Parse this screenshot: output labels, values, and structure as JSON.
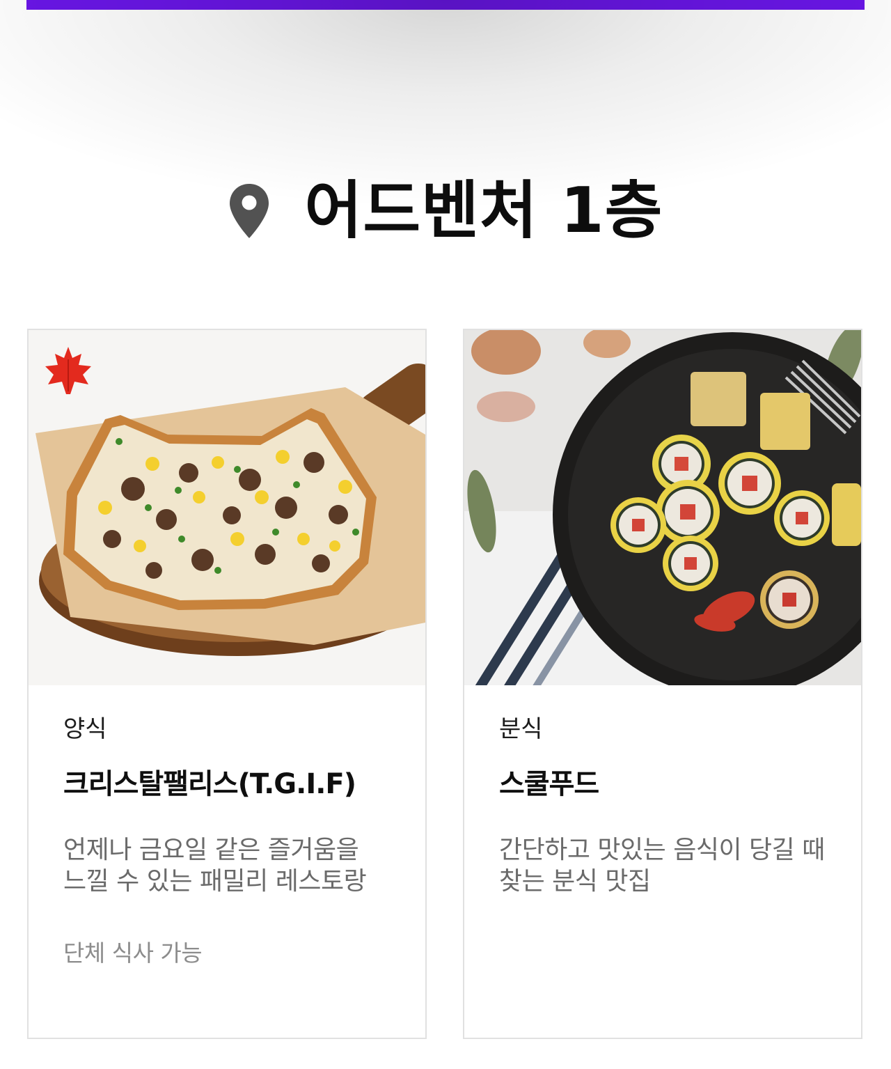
{
  "header": {
    "floor_title": "어드벤처 1층",
    "location_icon": "location-pin-icon"
  },
  "colors": {
    "top_bar": "#6a16e8",
    "title": "#0d0d0d",
    "card_border": "#e1e1e1",
    "description": "#6a6a6a",
    "note": "#8c8c8c"
  },
  "restaurants": [
    {
      "image": "pizza-photo",
      "badge_icon": "maple-leaf-icon",
      "category": "양식",
      "name": "크리스탈팰리스(T.G.I.F)",
      "description": "언제나 금요일 같은 즐거움을\n느낄 수 있는 패밀리 레스토랑",
      "note": "단체 식사 가능"
    },
    {
      "image": "gimbap-photo",
      "category": "분식",
      "name": "스쿨푸드",
      "description": "간단하고 맛있는 음식이 당길 때\n찾는 분식 맛집"
    }
  ]
}
